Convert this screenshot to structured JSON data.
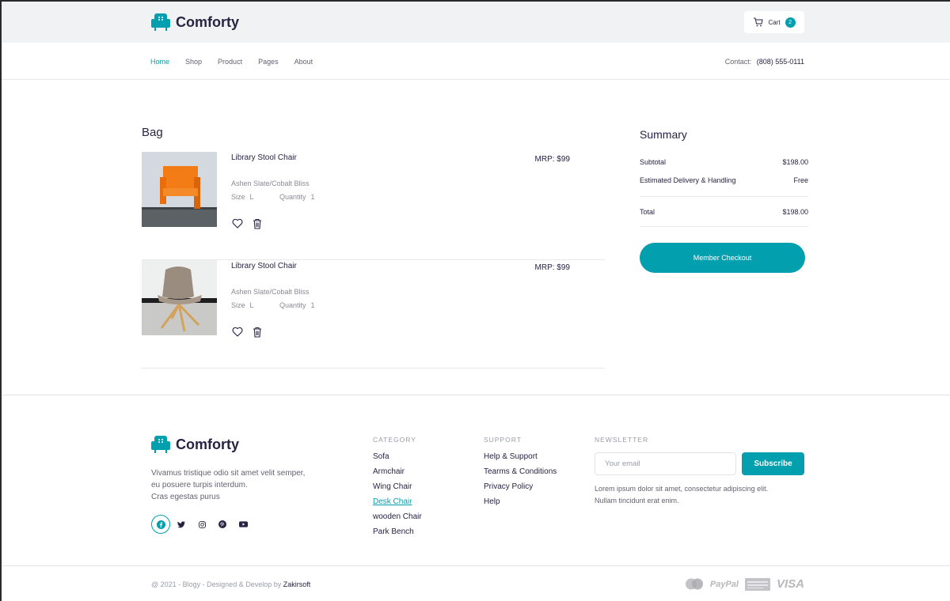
{
  "brand": {
    "name": "Comforty",
    "color": "#029fae"
  },
  "header": {
    "cart_label": "Cart",
    "cart_count": "2",
    "nav": [
      "Home",
      "Shop",
      "Product",
      "Pages",
      "About"
    ],
    "active_nav": "Home",
    "contact_label": "Contact:",
    "contact_phone": "(808) 555-0111"
  },
  "bag": {
    "title": "Bag",
    "items": [
      {
        "name": "Library Stool Chair",
        "price": "MRP: $99",
        "variant": "Ashen Slate/Cobalt Bliss",
        "size_label": "Size",
        "size": "L",
        "quantity_label": "Quantity",
        "quantity": "1",
        "image": "orange-chair"
      },
      {
        "name": "Library Stool Chair",
        "price": "MRP: $99",
        "variant": "Ashen Slate/Cobalt Bliss",
        "size_label": "Size",
        "size": "L",
        "quantity_label": "Quantity",
        "quantity": "1",
        "image": "taupe-lounge-chair"
      }
    ]
  },
  "summary": {
    "title": "Summary",
    "subtotal_label": "Subtotal",
    "subtotal": "$198.00",
    "delivery_label": "Estimated Delivery & Handling",
    "delivery": "Free",
    "total_label": "Total",
    "total": "$198.00",
    "checkout_label": "Member Checkout"
  },
  "footer": {
    "brand_name": "Comforty",
    "description": [
      "Vivamus tristique odio sit amet velit semper,",
      "eu posuere turpis interdum.",
      "Cras egestas purus"
    ],
    "socials": [
      "facebook-icon",
      "twitter-icon",
      "instagram-icon",
      "pinterest-icon",
      "youtube-icon"
    ],
    "category": {
      "title": "CATEGORY",
      "links": [
        "Sofa",
        "Armchair",
        "Wing Chair",
        "Desk Chair",
        "wooden Chair",
        "Park Bench"
      ],
      "active": "Desk Chair"
    },
    "support": {
      "title": "SUPPORT",
      "links": [
        "Help & Support",
        "Tearms & Conditions",
        "Privacy Policy",
        "Help"
      ]
    },
    "newsletter": {
      "title": "NEWSLETTER",
      "placeholder": "Your email",
      "button": "Subscribe",
      "text": [
        "Lorem ipsum dolor sit amet, consectetur adipiscing elit.",
        "Nullam tincidunt erat enim."
      ]
    },
    "copyright_prefix": "@ 2021 - Blogy - Designed & Develop by",
    "copyright_company": "Zakirsoft",
    "payments": [
      "mastercard-icon",
      "PayPal",
      "amex-icon",
      "VISA"
    ]
  }
}
